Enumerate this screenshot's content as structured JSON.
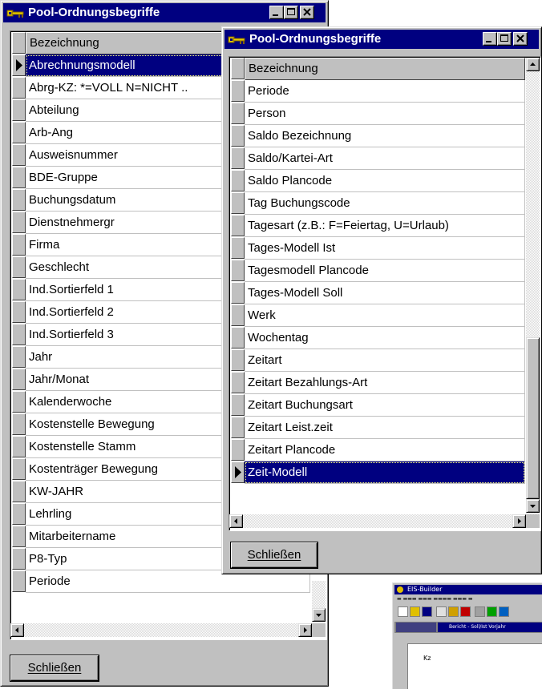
{
  "back_window": {
    "title": "Pool-Ordnungsbegriffe",
    "column_header": "Bezeichnung",
    "rows": [
      "Abrechnungsmodell",
      "Abrg-KZ: *=VOLL N=NICHT ..",
      "Abteilung",
      "Arb-Ang",
      "Ausweisnummer",
      "BDE-Gruppe",
      "Buchungsdatum",
      "Dienstnehmergr",
      "Firma",
      "Geschlecht",
      "Ind.Sortierfeld 1",
      "Ind.Sortierfeld 2",
      "Ind.Sortierfeld 3",
      "Jahr",
      "Jahr/Monat",
      "Kalenderwoche",
      "Kostenstelle Bewegung",
      "Kostenstelle Stamm",
      "Kostenträger Bewegung",
      "KW-JAHR",
      "Lehrling",
      "Mitarbeitername",
      "P8-Typ",
      "Periode"
    ],
    "selected_row": "Abrechnungsmodell",
    "close_button": "Schließen"
  },
  "front_window": {
    "title": "Pool-Ordnungsbegriffe",
    "column_header": "Bezeichnung",
    "rows": [
      "Periode",
      "Person",
      "Saldo Bezeichnung",
      "Saldo/Kartei-Art",
      "Saldo Plancode",
      "Tag Buchungscode",
      "Tagesart (z.B.: F=Feiertag, U=Urlaub)",
      "Tages-Modell Ist",
      "Tagesmodell Plancode",
      "Tages-Modell Soll",
      "Werk",
      "Wochentag",
      "Zeitart",
      "Zeitart Bezahlungs-Art",
      "Zeitart Buchungsart",
      "Zeitart Leist.zeit",
      "Zeitart Plancode",
      "Zeit-Modell"
    ],
    "selected_row": "Zeit-Modell",
    "close_button": "Schließen"
  },
  "eis_window": {
    "title": "EIS-Builder",
    "tab_label": "Bericht - Soll/Ist Vorjahr",
    "grid_cell": "Kz"
  },
  "icons": {
    "title_icon": "key-icon",
    "minimize": "minimize-icon",
    "maximize": "maximize-icon",
    "close": "close-icon",
    "row_indicator": "row-pointer-icon"
  },
  "colors": {
    "title_bar": "#000080",
    "selection": "#000080",
    "window_face": "#c0c0c0"
  }
}
